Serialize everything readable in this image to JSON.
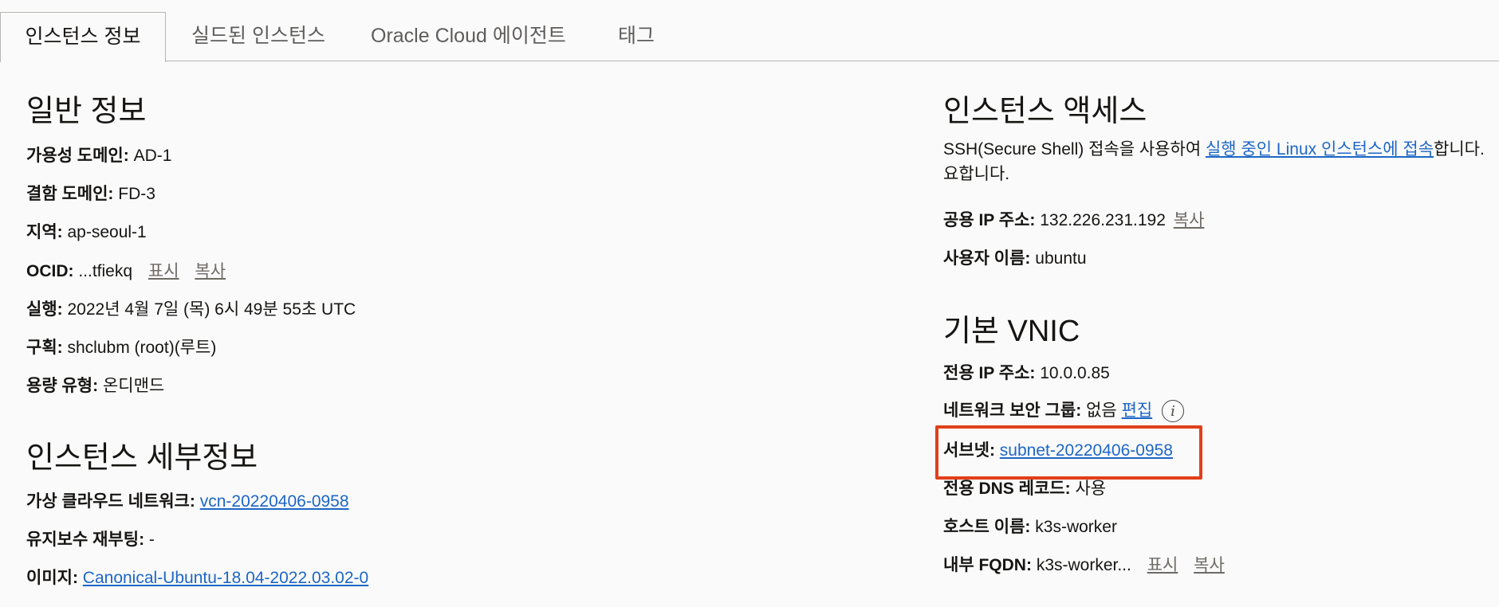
{
  "tabs": [
    "인스턴스 정보",
    "실드된 인스턴스",
    "Oracle Cloud 에이전트",
    "태그"
  ],
  "general": {
    "title": "일반 정보",
    "availability_domain": {
      "label": "가용성 도메인:",
      "value": "AD-1"
    },
    "fault_domain": {
      "label": "결함 도메인:",
      "value": "FD-3"
    },
    "region": {
      "label": "지역:",
      "value": "ap-seoul-1"
    },
    "ocid": {
      "label": "OCID:",
      "value": "...tfiekq",
      "show": "표시",
      "copy": "복사"
    },
    "launched": {
      "label": "실행:",
      "value": "2022년 4월 7일 (목) 6시 49분 55초 UTC"
    },
    "compartment": {
      "label": "구획:",
      "value": "shclubm (root)(루트)"
    },
    "capacity_type": {
      "label": "용량 유형:",
      "value": "온디맨드"
    }
  },
  "details": {
    "title": "인스턴스 세부정보",
    "vcn": {
      "label": "가상 클라우드 네트워크:",
      "value": "vcn-20220406-0958"
    },
    "maintenance_reboot": {
      "label": "유지보수 재부팅:",
      "value": "-"
    },
    "image": {
      "label": "이미지:",
      "value": "Canonical-Ubuntu-18.04-2022.03.02-0"
    }
  },
  "access": {
    "title": "인스턴스 액세스",
    "desc_prefix": "SSH(Secure Shell) 접속을 사용하여 ",
    "desc_link": "실행 중인 Linux 인스턴스에 접속",
    "desc_suffix": "합니다.",
    "desc_line2": "요합니다.",
    "public_ip": {
      "label": "공용 IP 주소:",
      "value": "132.226.231.192",
      "copy": "복사"
    },
    "username": {
      "label": "사용자 이름:",
      "value": "ubuntu"
    }
  },
  "vnic": {
    "title": "기본 VNIC",
    "private_ip": {
      "label": "전용 IP 주소:",
      "value": "10.0.0.85"
    },
    "nsg": {
      "label": "네트워크 보안 그룹:",
      "value": "없음",
      "edit": "편집"
    },
    "subnet": {
      "label": "서브넷:",
      "value": "subnet-20220406-0958"
    },
    "private_dns": {
      "label": "전용 DNS 레코드:",
      "value": "사용"
    },
    "hostname": {
      "label": "호스트 이름:",
      "value": "k3s-worker"
    },
    "fqdn": {
      "label": "내부 FQDN:",
      "value": "k3s-worker...",
      "show": "표시",
      "copy": "복사"
    }
  },
  "colors": {
    "link": "#1d66c6",
    "highlight": "#e0401a"
  }
}
